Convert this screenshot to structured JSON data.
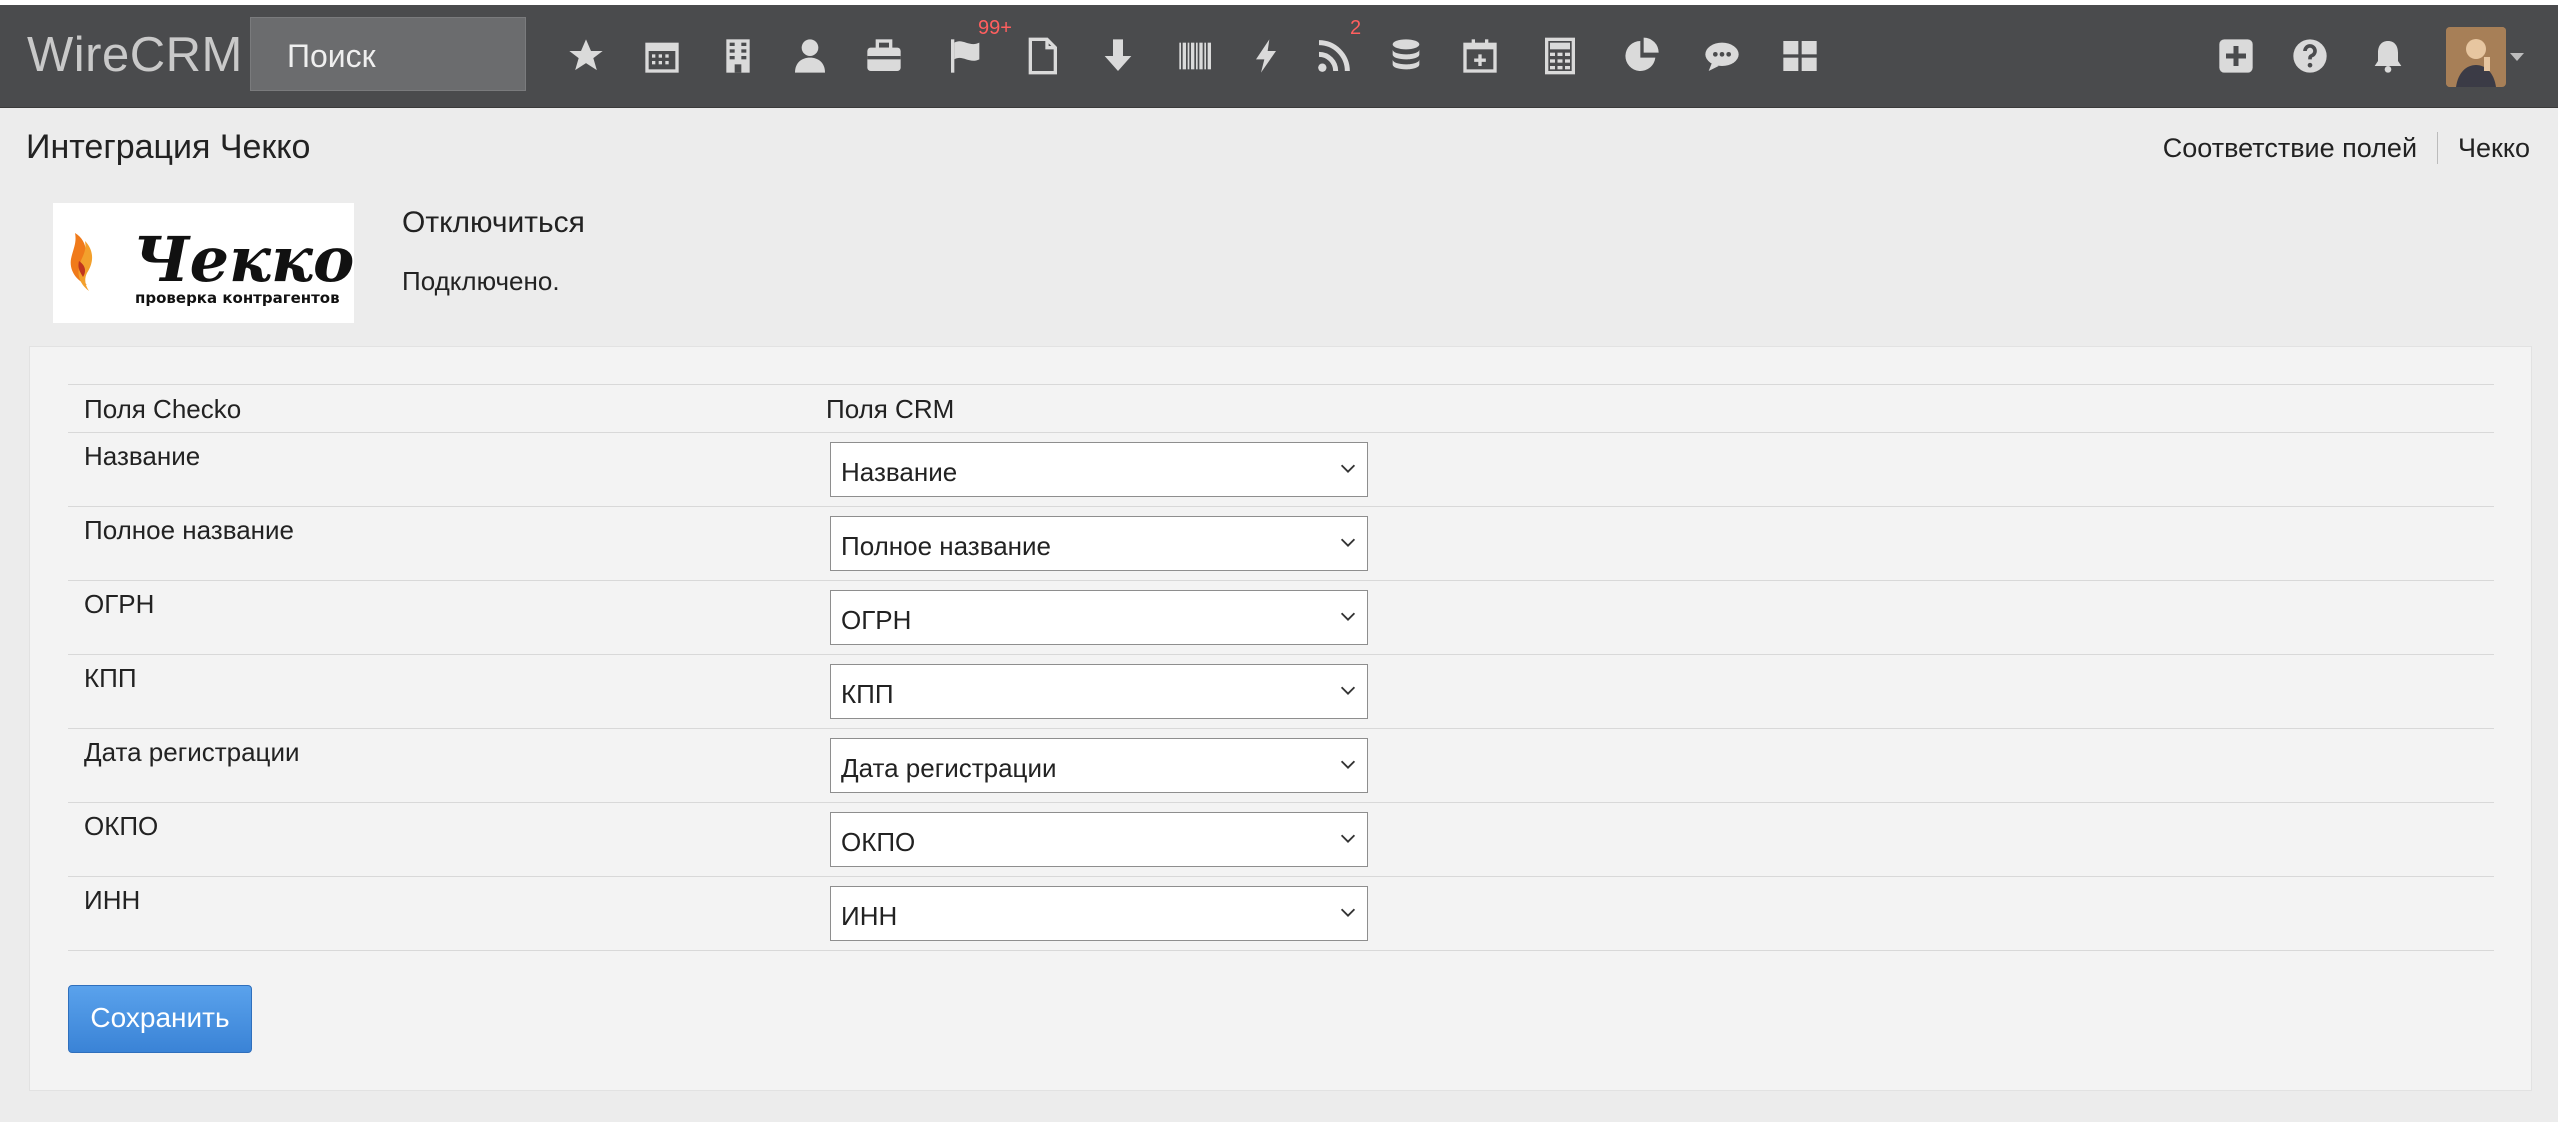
{
  "app": {
    "name": "WireCRM"
  },
  "search": {
    "placeholder": "Поиск"
  },
  "nav": {
    "icons": [
      "star-icon",
      "calendar-icon",
      "building-icon",
      "user-icon",
      "briefcase-icon",
      "flag-icon",
      "document-icon",
      "download-icon",
      "barcode-icon",
      "lightning-icon",
      "rss-icon",
      "database-icon",
      "calendar-add-icon",
      "calculator-icon",
      "pie-chart-icon",
      "chat-icon",
      "grid-icon"
    ],
    "flag_badge": "99+",
    "rss_badge": "2",
    "right_icons": [
      "plus-square-icon",
      "help-icon",
      "bell-icon"
    ]
  },
  "page": {
    "title": "Интеграция Чекко",
    "links": [
      "Соответствие полей",
      "Чекко"
    ]
  },
  "integration": {
    "logo_word": "Чекко",
    "logo_tagline": "проверка контрагентов",
    "disconnect_label": "Отключиться",
    "status": "Подключено."
  },
  "mapping": {
    "headers": {
      "source": "Поля Checko",
      "target": "Поля CRM"
    },
    "rows": [
      {
        "label": "Название",
        "value": "Название"
      },
      {
        "label": "Полное название",
        "value": "Полное название"
      },
      {
        "label": "ОГРН",
        "value": "ОГРН"
      },
      {
        "label": "КПП",
        "value": "КПП"
      },
      {
        "label": "Дата регистрации",
        "value": "Дата регистрации"
      },
      {
        "label": "ОКПО",
        "value": "ОКПО"
      },
      {
        "label": "ИНН",
        "value": "ИНН"
      }
    ],
    "save_label": "Сохранить"
  },
  "colors": {
    "topbar": "#4a4b4d",
    "accent_button": "#3a83d6",
    "badge": "#ff5f5f"
  }
}
